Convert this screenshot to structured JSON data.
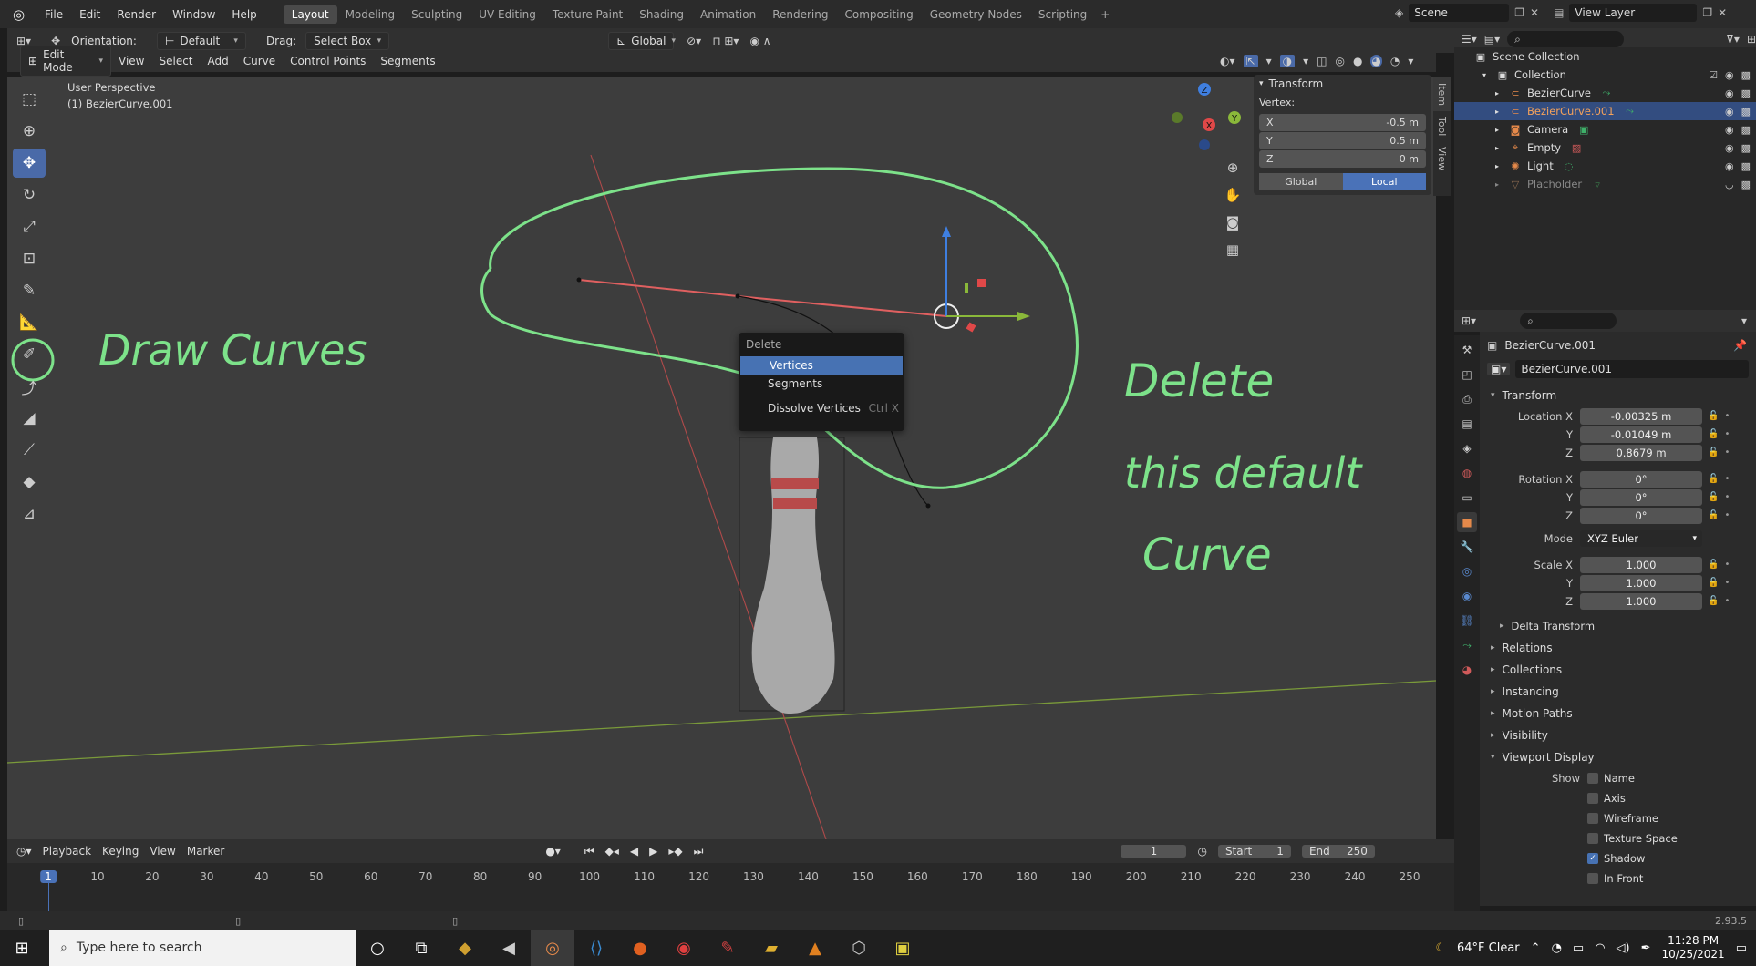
{
  "app": {
    "logo": "blender-logo-icon"
  },
  "topbar": {
    "menus": [
      "File",
      "Edit",
      "Render",
      "Window",
      "Help"
    ],
    "workspaces": [
      "Layout",
      "Modeling",
      "Sculpting",
      "UV Editing",
      "Texture Paint",
      "Shading",
      "Animation",
      "Rendering",
      "Compositing",
      "Geometry Nodes",
      "Scripting"
    ],
    "active_workspace": "Layout",
    "add_tab": "+",
    "scene": "Scene",
    "view_layer": "View Layer"
  },
  "vp_header1": {
    "orientation_label": "Orientation:",
    "orientation_value": "Default",
    "drag_label": "Drag:",
    "drag_value": "Select Box",
    "transform_orient": "Global"
  },
  "vp_header2": {
    "mode": "Edit Mode",
    "menus": [
      "View",
      "Select",
      "Add",
      "Curve",
      "Control Points",
      "Segments"
    ]
  },
  "viewport": {
    "perspective": "User Perspective",
    "object": "(1) BezierCurve.001",
    "annotations": {
      "a1": "Draw Curves",
      "a2": "Delete",
      "a3": "this default",
      "a4": "Curve"
    },
    "gizmo": {
      "x": "X",
      "y": "Y",
      "z": "Z"
    }
  },
  "npanel": {
    "header": "Transform",
    "vertex_label": "Vertex:",
    "rows": [
      {
        "label": "X",
        "value": "-0.5 m"
      },
      {
        "label": "Y",
        "value": "0.5 m"
      },
      {
        "label": "Z",
        "value": "0 m"
      }
    ],
    "global": "Global",
    "local": "Local",
    "tabs": [
      "Item",
      "Tool",
      "View"
    ]
  },
  "delete_menu": {
    "title": "Delete",
    "items": [
      {
        "label": "Vertices",
        "shortcut": ""
      },
      {
        "label": "Segments",
        "shortcut": ""
      },
      {
        "label": "Dissolve Vertices",
        "shortcut": "Ctrl X"
      }
    ]
  },
  "outliner": {
    "root": "Scene Collection",
    "collection": "Collection",
    "items": [
      {
        "name": "BezierCurve",
        "color": "#e5894a"
      },
      {
        "name": "BezierCurve.001",
        "color": "#e5894a"
      },
      {
        "name": "Camera",
        "color": "#e5894a"
      },
      {
        "name": "Empty",
        "color": "#e5894a"
      },
      {
        "name": "Light",
        "color": "#e5894a"
      },
      {
        "name": "Placholder",
        "color": "#8a6a50"
      }
    ]
  },
  "properties": {
    "object_name": "BezierCurve.001",
    "data_name": "BezierCurve.001",
    "transform_title": "Transform",
    "location": [
      {
        "label": "Location X",
        "value": "-0.00325 m"
      },
      {
        "label": "Y",
        "value": "-0.01049 m"
      },
      {
        "label": "Z",
        "value": "0.8679 m"
      }
    ],
    "rotation": [
      {
        "label": "Rotation X",
        "value": "0°"
      },
      {
        "label": "Y",
        "value": "0°"
      },
      {
        "label": "Z",
        "value": "0°"
      }
    ],
    "mode_label": "Mode",
    "mode_value": "XYZ Euler",
    "scale": [
      {
        "label": "Scale X",
        "value": "1.000"
      },
      {
        "label": "Y",
        "value": "1.000"
      },
      {
        "label": "Z",
        "value": "1.000"
      }
    ],
    "delta": "Delta Transform",
    "sections": [
      "Relations",
      "Collections",
      "Instancing",
      "Motion Paths",
      "Visibility"
    ],
    "viewport_display": "Viewport Display",
    "show_label": "Show",
    "show_items": [
      {
        "label": "Name",
        "checked": false
      },
      {
        "label": "Axis",
        "checked": false
      },
      {
        "label": "Wireframe",
        "checked": false
      },
      {
        "label": "Texture Space",
        "checked": false
      },
      {
        "label": "Shadow",
        "checked": true
      },
      {
        "label": "In Front",
        "checked": false
      }
    ]
  },
  "timeline": {
    "menus": [
      "Playback",
      "Keying",
      "View",
      "Marker"
    ],
    "current_frame": "1",
    "start_label": "Start",
    "start": "1",
    "end_label": "End",
    "end": "250",
    "ticks": [
      "1",
      "10",
      "20",
      "30",
      "40",
      "50",
      "60",
      "70",
      "80",
      "90",
      "100",
      "110",
      "120",
      "130",
      "140",
      "150",
      "160",
      "170",
      "180",
      "190",
      "200",
      "210",
      "220",
      "230",
      "240",
      "250"
    ]
  },
  "statusbar": {
    "version": "2.93.5"
  },
  "taskbar": {
    "search_placeholder": "Type here to search",
    "weather": "64°F  Clear",
    "time": "11:28 PM",
    "date": "10/25/2021"
  }
}
